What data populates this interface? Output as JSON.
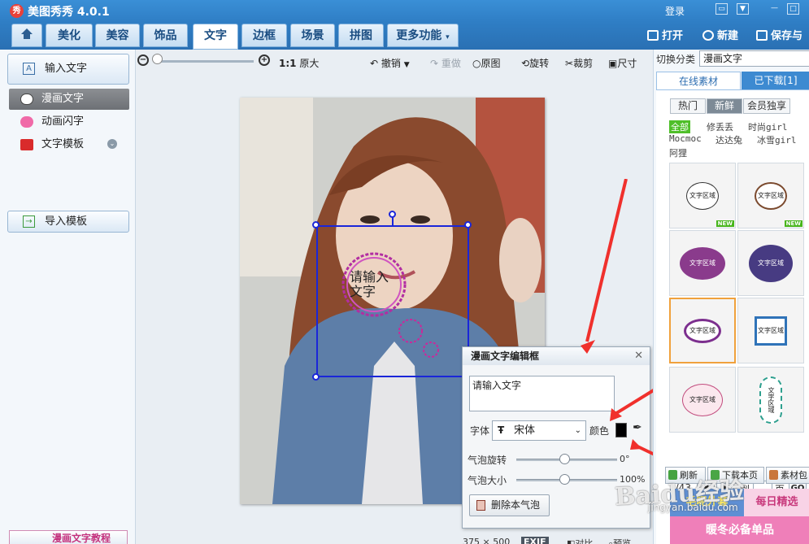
{
  "app": {
    "title": "美图秀秀 4.0.1",
    "logo": "秀",
    "login": "登录"
  },
  "nav": {
    "tabs": [
      "美化",
      "美容",
      "饰品",
      "文字",
      "边框",
      "场景",
      "拼图",
      "更多功能"
    ],
    "active": "文字",
    "open": "打开",
    "new": "新建",
    "save": "保存与"
  },
  "left": {
    "input_text": "输入文字",
    "items": [
      "漫画文字",
      "动画闪字",
      "文字模板"
    ],
    "import_template": "导入模板",
    "tutorial": "漫画文字教程"
  },
  "toolbar": {
    "ratio": "1:1",
    "original_size": "原大",
    "undo": "撤销",
    "redo": "重做",
    "original": "原图",
    "rotate": "旋转",
    "crop": "裁剪",
    "size": "尺寸"
  },
  "canvas": {
    "bubble_text_line1": "请输入",
    "bubble_text_line2": "文字"
  },
  "dialog": {
    "title": "漫画文字编辑框",
    "text_value": "请输入文字",
    "font_label": "字体",
    "font_value": "宋体",
    "color_label": "颜色",
    "color_value": "#000000",
    "rotate_label": "气泡旋转",
    "rotate_value": "0°",
    "size_label": "气泡大小",
    "size_value": "100%",
    "delete_button": "删除本气泡"
  },
  "right": {
    "category_label": "切换分类",
    "category_value": "漫画文字",
    "tab_online": "在线素材",
    "tab_downloaded": "已下载[1]",
    "filters": [
      "热门",
      "新鲜",
      "会员独享"
    ],
    "filter_active": "新鲜",
    "authors": [
      "全部",
      "修丢丢",
      "时尚girl",
      "Mocmoc",
      "达达兔",
      "冰雪girl",
      "阿狸"
    ],
    "author_active": "全部",
    "thumb_text": [
      "文字区域",
      "文字区域",
      "文字区域",
      "文字区域",
      "文字区域",
      "文字区域",
      "文字区域",
      "文字区域"
    ],
    "new_badge": "NEW",
    "page": "1/43",
    "goto": "到",
    "page_unit": "页",
    "go": "GO",
    "refresh": "刷新",
    "download_page": "下载本页",
    "material_pack": "素材包",
    "promo": [
      "毛呢外套",
      "每日精选",
      "暖冬必备单品"
    ]
  },
  "status": {
    "dims": "375 × 500",
    "exif": "EXIF",
    "compare": "对比",
    "preview": "预览"
  },
  "watermark": {
    "text": "Baidu经验",
    "url": "jingyan.baidu.com"
  }
}
